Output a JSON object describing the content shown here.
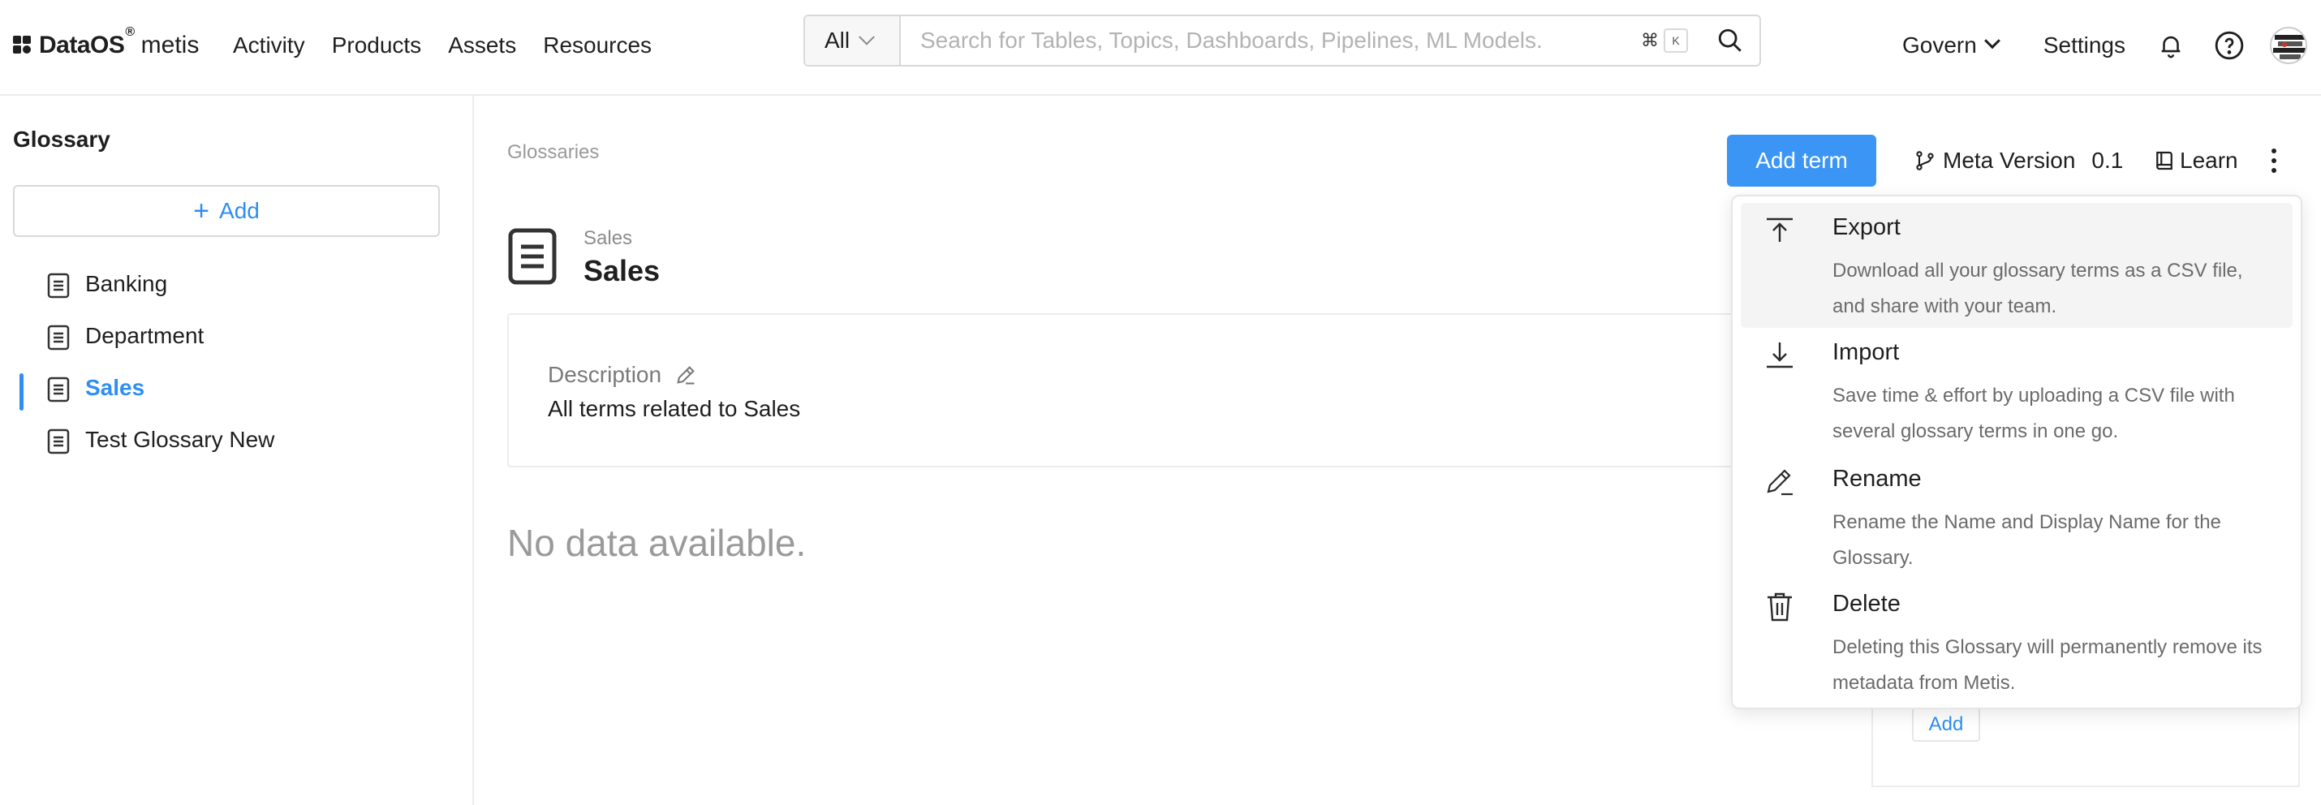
{
  "header": {
    "logo_brand": "DataOS",
    "logo_reg": "®",
    "logo_sub": "metis",
    "nav": [
      "Activity",
      "Products",
      "Assets",
      "Resources"
    ],
    "search": {
      "scope": "All",
      "placeholder": "Search for Tables, Topics, Dashboards, Pipelines, ML Models.",
      "shortcut_cmd": "⌘",
      "shortcut_key": "K"
    },
    "govern_label": "Govern",
    "settings_label": "Settings"
  },
  "sidebar": {
    "title": "Glossary",
    "add_label": "Add",
    "items": [
      {
        "label": "Banking"
      },
      {
        "label": "Department"
      },
      {
        "label": "Sales"
      },
      {
        "label": "Test Glossary New"
      }
    ]
  },
  "main": {
    "breadcrumb": "Glossaries",
    "title_sub": "Sales",
    "title": "Sales",
    "description_label": "Description",
    "description_text": "All terms related to Sales",
    "empty_text": "No data available.",
    "add_term_label": "Add term",
    "meta_version_label": "Meta Version",
    "meta_version_value": "0.1",
    "learn_label": "Learn",
    "right_add_label": "Add"
  },
  "menu": {
    "items": [
      {
        "title": "Export",
        "desc": "Download all your glossary terms as a CSV file, and share with your team.",
        "icon": "upload-icon"
      },
      {
        "title": "Import",
        "desc": "Save time & effort by uploading a CSV file with several glossary terms in one go.",
        "icon": "download-icon"
      },
      {
        "title": "Rename",
        "desc": "Rename the Name and Display Name for the Glossary.",
        "icon": "pencil-icon"
      },
      {
        "title": "Delete",
        "desc": "Deleting this Glossary will permanently remove its metadata from Metis.",
        "icon": "trash-icon"
      }
    ]
  },
  "colors": {
    "accent": "#2f8ff0",
    "primary_button": "#3b95f5",
    "muted_text": "#9a9a9a",
    "border": "#ececec"
  }
}
